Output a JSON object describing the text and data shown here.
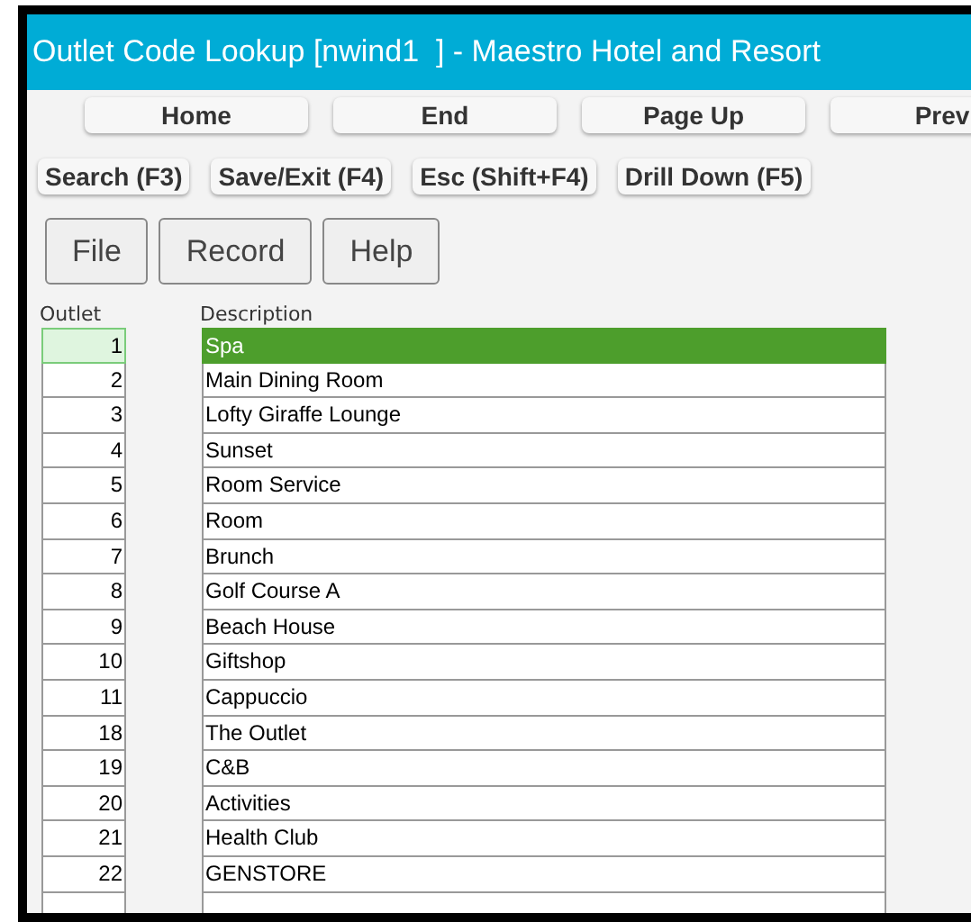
{
  "window": {
    "title": "Outlet Code Lookup [nwind1  ] - Maestro Hotel and Resort"
  },
  "nav_buttons": [
    "Home",
    "End",
    "Page Up",
    "Prev"
  ],
  "function_buttons": [
    "Search (F3)",
    "Save/Exit (F4)",
    "Esc (Shift+F4)",
    "Drill Down (F5)"
  ],
  "menu": [
    "File",
    "Record",
    "Help"
  ],
  "table": {
    "columns": [
      "Outlet",
      "Description"
    ],
    "rows": [
      {
        "outlet": "1",
        "description": "Spa",
        "selected": true
      },
      {
        "outlet": "2",
        "description": "Main Dining Room",
        "selected": false
      },
      {
        "outlet": "3",
        "description": "Lofty Giraffe Lounge",
        "selected": false
      },
      {
        "outlet": "4",
        "description": "Sunset",
        "selected": false
      },
      {
        "outlet": "5",
        "description": "Room Service",
        "selected": false
      },
      {
        "outlet": "6",
        "description": "Room",
        "selected": false
      },
      {
        "outlet": "7",
        "description": "Brunch",
        "selected": false
      },
      {
        "outlet": "8",
        "description": "Golf Course A",
        "selected": false
      },
      {
        "outlet": "9",
        "description": "Beach House",
        "selected": false
      },
      {
        "outlet": "10",
        "description": "Giftshop",
        "selected": false
      },
      {
        "outlet": "11",
        "description": "Cappuccio",
        "selected": false
      },
      {
        "outlet": "18",
        "description": "The Outlet",
        "selected": false
      },
      {
        "outlet": "19",
        "description": "C&B",
        "selected": false
      },
      {
        "outlet": "20",
        "description": "Activities",
        "selected": false
      },
      {
        "outlet": "21",
        "description": "Health Club",
        "selected": false
      },
      {
        "outlet": "22",
        "description": "GENSTORE",
        "selected": false
      }
    ]
  }
}
